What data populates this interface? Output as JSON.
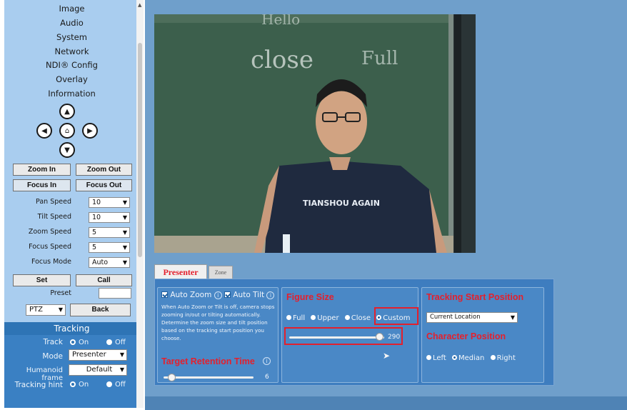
{
  "sidebar": {
    "menu": [
      "Image",
      "Audio",
      "System",
      "Network",
      "NDI® Config",
      "Overlay",
      "Information"
    ],
    "buttons": {
      "zoom_in": "Zoom In",
      "zoom_out": "Zoom Out",
      "focus_in": "Focus In",
      "focus_out": "Focus Out",
      "set": "Set",
      "call": "Call",
      "back": "Back"
    },
    "speeds": [
      {
        "label": "Pan Speed",
        "value": "10"
      },
      {
        "label": "Tilt Speed",
        "value": "10"
      },
      {
        "label": "Zoom Speed",
        "value": "5"
      },
      {
        "label": "Focus Speed",
        "value": "5"
      },
      {
        "label": "Focus Mode",
        "value": "Auto"
      }
    ],
    "preset_label": "Preset",
    "preset_value": "",
    "mode_select": "PTZ",
    "tracking": {
      "header": "Tracking",
      "track_label": "Track",
      "on": "On",
      "off": "Off",
      "mode_label": "Mode",
      "mode_value": "Presenter",
      "frame_label": "Humanoid frame",
      "frame_value": "Default",
      "hint_label": "Tracking hint"
    }
  },
  "tabs": [
    "Presenter",
    "Zone"
  ],
  "presenter": {
    "auto_zoom": "Auto Zoom",
    "auto_tilt": "Auto Tilt",
    "note": "When Auto Zoom or Tilt is off, camera stops zooming in/out or tilting automatically. Determine the zoom size and tilt position based on the tracking start position you choose.",
    "retention_title": "Target Retention Time",
    "retention_value": "6",
    "retention_level": 0.05,
    "figure_title": "Figure Size",
    "figure_options": [
      "Full",
      "Upper",
      "Close",
      "Custom"
    ],
    "figure_selected": "Custom",
    "figure_value": "290",
    "figure_level": 0.95,
    "start_title": "Tracking Start Position",
    "start_value": "Current Location",
    "char_title": "Character Position",
    "char_options": [
      "Left",
      "Median",
      "Right"
    ],
    "char_selected": "Median"
  },
  "video": {
    "board_text_1": "Hello",
    "board_text_2": "Full",
    "board_text_3": "close",
    "shirt_text": "TIANSHOU AGAIN"
  },
  "colors": {
    "accent_red": "#e4202d",
    "panel_blue": "#3e7dbf",
    "sidebar_blue": "#a9cdef"
  }
}
